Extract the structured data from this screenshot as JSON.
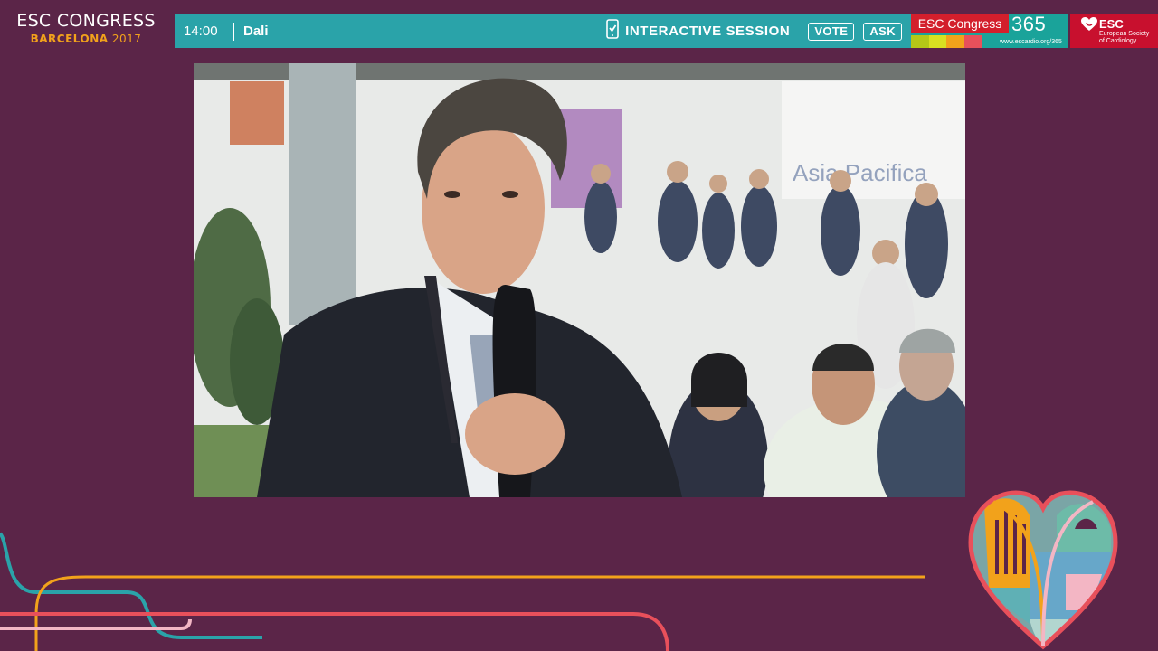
{
  "brand": {
    "title": "ESC CONGRESS",
    "city": "BARCELONA",
    "year": "2017"
  },
  "session_bar": {
    "time": "14:00",
    "room": "Dali",
    "session_label": "INTERACTIVE SESSION",
    "vote_label": "VOTE",
    "ask_label": "ASK",
    "background_color": "#2aa3a9"
  },
  "congress365": {
    "label": "ESC Congress",
    "number": "365",
    "url": "www.escardio.org/365",
    "stripe_colors": [
      "#b5c817",
      "#d9e021",
      "#f2a21b",
      "#e8505b",
      "#1aa39a"
    ]
  },
  "esc_logo": {
    "name": "ESC",
    "full_name": "European Society of Cardiology",
    "color": "#c8102e"
  },
  "video": {
    "description_icon": "video-feed"
  },
  "colors": {
    "background": "#5b2548",
    "accent_orange": "#f2a21b",
    "accent_teal": "#2aa3a9",
    "accent_red": "#e8505b",
    "accent_pink": "#f3b6c4"
  }
}
